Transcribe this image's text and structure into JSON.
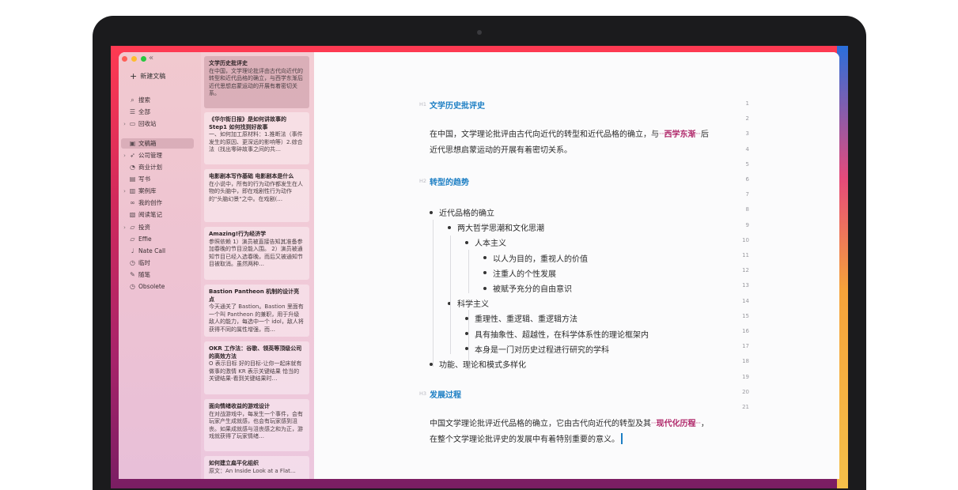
{
  "sidebar": {
    "new_doc": "新建文稿",
    "items": [
      {
        "label": "搜索",
        "icon": "search-icon",
        "glyph": "⌕",
        "chev": false
      },
      {
        "label": "全部",
        "icon": "all-docs-icon",
        "glyph": "☰",
        "chev": false
      },
      {
        "label": "回收站",
        "icon": "trash-icon",
        "glyph": "▭",
        "chev": true
      },
      {
        "label": "文稿箱",
        "icon": "inbox-icon",
        "glyph": "▣",
        "chev": false,
        "active": true
      },
      {
        "label": "公司管理",
        "icon": "rocket-icon",
        "glyph": "➶",
        "chev": true
      },
      {
        "label": "商业计划",
        "icon": "gauge-icon",
        "glyph": "◔",
        "chev": false
      },
      {
        "label": "写书",
        "icon": "book-icon",
        "glyph": "▤",
        "chev": false
      },
      {
        "label": "案例库",
        "icon": "chart-icon",
        "glyph": "▥",
        "chev": true
      },
      {
        "label": "我的创作",
        "icon": "glasses-icon",
        "glyph": "∞",
        "chev": false
      },
      {
        "label": "阅读笔记",
        "icon": "reading-icon",
        "glyph": "▧",
        "chev": false
      },
      {
        "label": "投资",
        "icon": "folder-icon",
        "glyph": "▱",
        "chev": true
      },
      {
        "label": "Effie",
        "icon": "folder-icon",
        "glyph": "▱",
        "chev": false
      },
      {
        "label": "Nate Call",
        "icon": "mic-icon",
        "glyph": "♩",
        "chev": false
      },
      {
        "label": "临时",
        "icon": "clock-icon",
        "glyph": "◷",
        "chev": false
      },
      {
        "label": "随笔",
        "icon": "pen-icon",
        "glyph": "✎",
        "chev": false
      },
      {
        "label": "Obsolete",
        "icon": "clock-icon",
        "glyph": "◷",
        "chev": false
      }
    ]
  },
  "doc_list": [
    {
      "title": "文学历史批评史",
      "body": "在中国，文学理论批评由古代向近代的转型和近代品格的确立，与西学东渐后近代思想启蒙运动的开展有着密切关系。",
      "active": true
    },
    {
      "title": "《华尔街日报》是如何讲故事的Step1 如何找到好故事",
      "body": "一、如何加工原材料：1.推断法（事件发生的原因、更深远的影响等）2.综合法（找出零碎故事之间的共…"
    },
    {
      "title": "电影剧本写作基础 电影剧本是什么",
      "body": "在小说中，所有的行为动作都发生在人物的头脑中，即在戏剧性行为动作的\"头脑幻景\"之中。在戏剧(…"
    },
    {
      "title": "Amazing!行为经济学",
      "body": "参照依赖 1）演员被直接告知其准备参加春晚的节目没能入围。 2）演员被通知节目已经入选春晚，而后又被通知节目被取消。虽然两种…"
    },
    {
      "title": "Bastion Pantheon 机制的设计亮点",
      "body": "今天通关了 Bastion。Bastion 里面有一个叫 Pantheon 的兼职，用于升级敌人的能力，每选中一个 idol，敌人将获得不同的属性增强，而…"
    },
    {
      "title": "OKR 工作法：谷歌、领英等顶级公司的高效方法",
      "body": "O 表示目标 好的目标-让你一起床就有做事的激情 KR 表示关键结果 恰当的关键结果-看到关键结果时…"
    },
    {
      "title": "面向情绪收益的游戏设计",
      "body": "在对战游戏中，每发生一个事件，会有玩家产生成就感，也会有玩家感到沮丧。如果成就感与沮丧感之和为正，游戏就获得了玩家情绪…"
    },
    {
      "title": "如何建立扁平化组织",
      "body": "原文：An Inside Look at a Flat…"
    }
  ],
  "editor": {
    "line_numbers": [
      "1",
      "2",
      "3",
      "4",
      "5",
      "6",
      "7",
      "8",
      "9",
      "10",
      "11",
      "12",
      "13",
      "14",
      "15",
      "16",
      "17",
      "18",
      "19",
      "20",
      "21"
    ],
    "h1_marker": "H1",
    "h2_marker": "H2",
    "h3_marker": "H3",
    "heading1": "文学历史批评史",
    "para1_a": "在中国，文学理论批评由古代向近代的转型和近代品格的确立，与",
    "para1_hl": "西学东渐",
    "para1_b": "后",
    "para1_line2": "近代思想启蒙运动的开展有着密切关系。",
    "heading2": "转型的趋势",
    "list": [
      "近代品格的确立",
      "两大哲学思潮和文化思潮",
      "人本主义",
      "以人为目的，重视人的价值",
      "注重人的个性发展",
      "被赋予充分的自由意识",
      "科学主义",
      "重理性、重逻辑、重逻辑方法",
      "具有抽象性、超越性，在科学体系性的理论框架内",
      "本身是一门对历史过程进行研究的学科",
      "功能、理论和模式多样化"
    ],
    "heading3": "发展过程",
    "para2_a": "中国文学理论批评近代品格的确立，它由古代向近代的转型及其",
    "para2_hl": "现代化历程",
    "para2_b": "，",
    "para2_line2": "在整个文学理论批评史的发展中有着特别重要的意义。",
    "quote_open": "\"\"",
    "quote_close": "\"\""
  }
}
